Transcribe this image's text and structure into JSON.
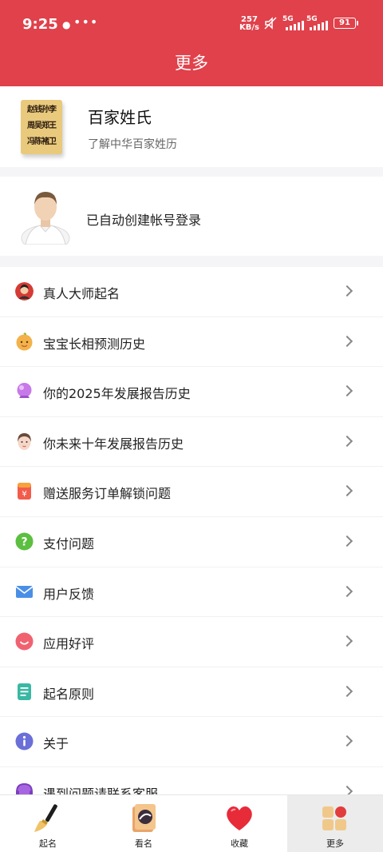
{
  "status_bar": {
    "time": "9:25",
    "dots": "•••",
    "speed_value": "257",
    "speed_unit": "KB/s",
    "sim1_label": "5G",
    "sim2_label": "5G",
    "battery": "91"
  },
  "app_bar": {
    "title": "更多"
  },
  "book_card": {
    "cover_lines": [
      "赵钱孙李",
      "周吴郑王",
      "冯陈褚卫"
    ],
    "title": "百家姓氏",
    "subtitle": "了解中华百家姓历"
  },
  "user_card": {
    "text": "已自动创建帐号登录"
  },
  "menu": {
    "items": [
      {
        "label": "真人大师起名",
        "icon": "master-avatar-icon"
      },
      {
        "label": "宝宝长相预测历史",
        "icon": "baby-face-icon"
      },
      {
        "label": "你的2025年发展报告历史",
        "icon": "crystal-ball-icon"
      },
      {
        "label": "你未来十年发展报告历史",
        "icon": "woman-face-icon"
      },
      {
        "label": "赠送服务订单解锁问题",
        "icon": "yuan-red-packet-icon"
      },
      {
        "label": "支付问题",
        "icon": "question-icon"
      },
      {
        "label": "用户反馈",
        "icon": "mail-icon"
      },
      {
        "label": "应用好评",
        "icon": "smile-icon"
      },
      {
        "label": "起名原则",
        "icon": "document-icon"
      },
      {
        "label": "关于",
        "icon": "info-icon"
      },
      {
        "label": "遇到问题请联系客服",
        "icon": "customer-service-icon"
      }
    ]
  },
  "tab_bar": {
    "tabs": [
      {
        "label": "起名",
        "icon": "brush-icon"
      },
      {
        "label": "看名",
        "icon": "mirror-icon"
      },
      {
        "label": "收藏",
        "icon": "heart-icon"
      },
      {
        "label": "更多",
        "icon": "more-grid-icon",
        "active": true
      }
    ]
  },
  "colors": {
    "accent": "#e0414b",
    "background": "#f5f5f7"
  }
}
